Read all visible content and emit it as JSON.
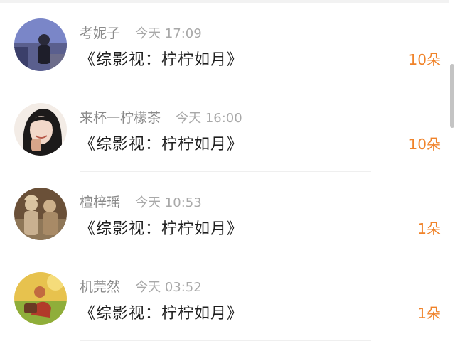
{
  "comments": [
    {
      "user": "考妮子",
      "time": "今天 17:09",
      "title": "《综影视：柠柠如月》",
      "gift": "10朵",
      "avatar_icon": "avatar-photo-1"
    },
    {
      "user": "来杯一柠檬茶",
      "time": "今天 16:00",
      "title": "《综影视：柠柠如月》",
      "gift": "10朵",
      "avatar_icon": "avatar-photo-2"
    },
    {
      "user": "檀梓瑶",
      "time": "今天 10:53",
      "title": "《综影视：柠柠如月》",
      "gift": "1朵",
      "avatar_icon": "avatar-photo-3"
    },
    {
      "user": "机莞然",
      "time": "今天 03:52",
      "title": "《综影视：柠柠如月》",
      "gift": "1朵",
      "avatar_icon": "avatar-photo-4"
    }
  ],
  "colors": {
    "gift_accent": "#f0832a",
    "username": "#8a8a8a",
    "timestamp": "#a8a8a8",
    "title": "#1f1f1f"
  }
}
